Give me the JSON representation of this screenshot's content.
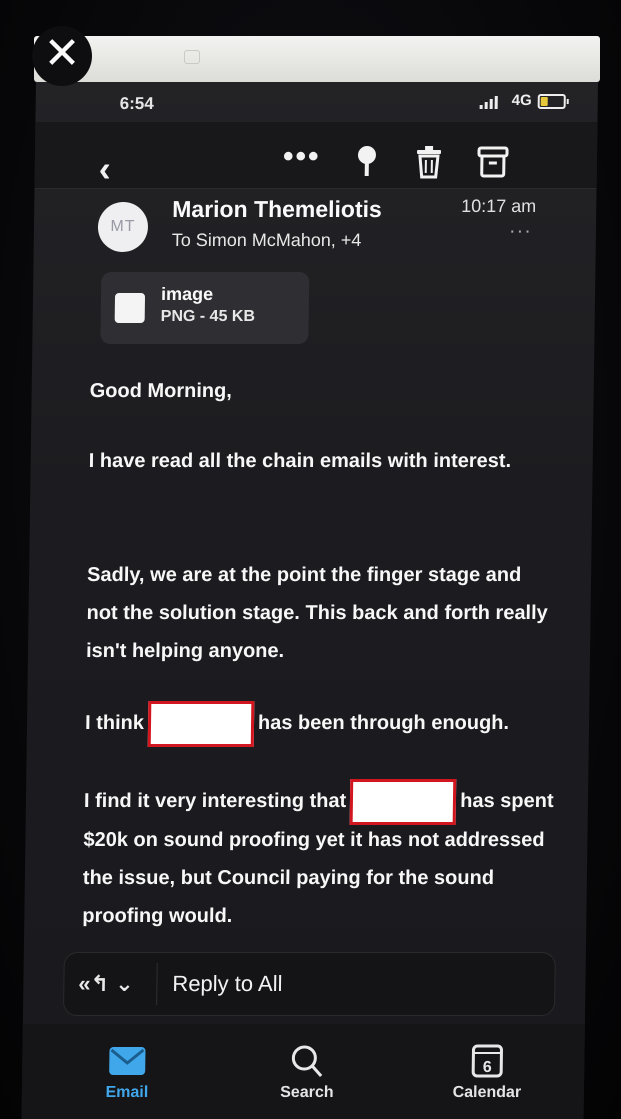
{
  "status_bar": {
    "time": "6:54",
    "network": "4G",
    "battery_level": 0.35
  },
  "toolbar": {
    "more_label": "•••"
  },
  "email": {
    "avatar_initials": "MT",
    "sender_name": "Marion Themeliotis",
    "recipients": "To Simon McMahon, +4",
    "received_time": "10:17 am",
    "attachment": {
      "name": "image",
      "type_size": "PNG - 45 KB"
    },
    "body": {
      "greeting": "Good Morning,",
      "para1": "I have read all the chain emails with interest.",
      "para2": "Sadly, we are at the point the finger stage and not the solution stage. This back and forth really isn't helping anyone.",
      "para3_before": "I think",
      "para3_after": "has been through enough.",
      "para4_before": "I find it very interesting that",
      "para4_after": "has spent $20k on sound proofing yet it has not addressed the issue, but Council paying for the sound proofing would."
    }
  },
  "reply": {
    "label": "Reply to All"
  },
  "tabs": [
    {
      "label": "Email",
      "icon": "envelope-icon",
      "active": true
    },
    {
      "label": "Search",
      "icon": "search-icon",
      "active": false
    },
    {
      "label": "Calendar",
      "icon": "calendar-icon",
      "active": false,
      "day": "6"
    }
  ],
  "colors": {
    "accent": "#3fa7ea",
    "redaction_border": "#d2161f"
  }
}
